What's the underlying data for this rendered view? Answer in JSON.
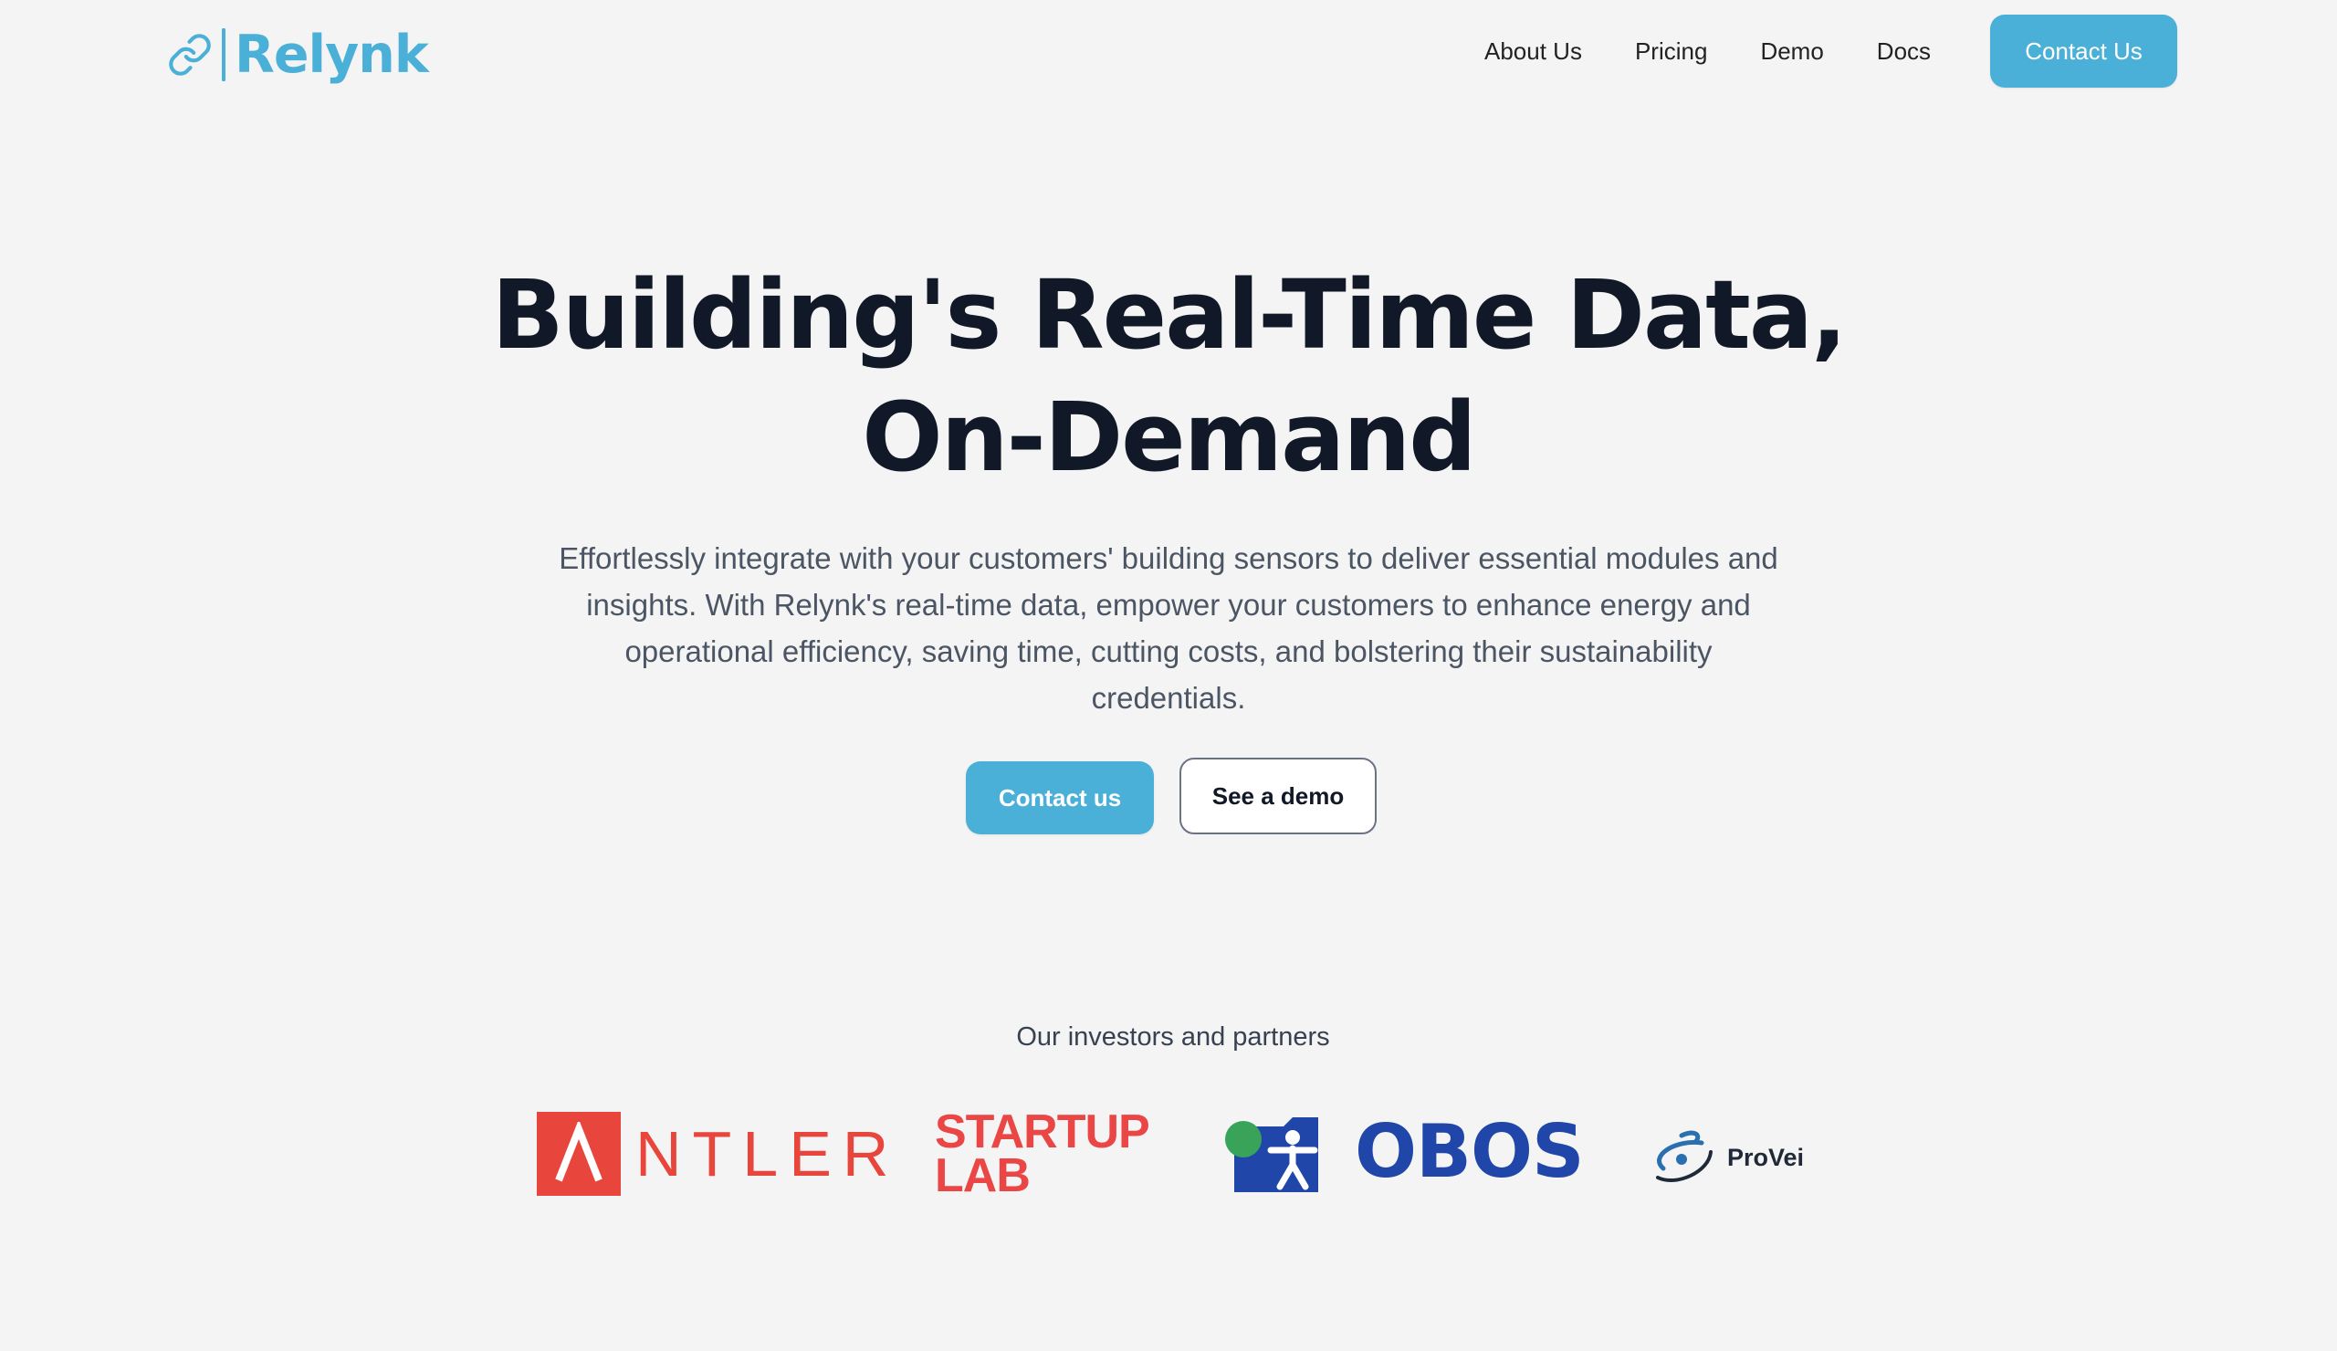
{
  "header": {
    "logo_text": "Relynk",
    "nav": [
      {
        "label": "About Us"
      },
      {
        "label": "Pricing"
      },
      {
        "label": "Demo"
      },
      {
        "label": "Docs"
      }
    ],
    "cta_label": "Contact Us"
  },
  "hero": {
    "title_line1": "Building's Real-Time Data,",
    "title_line2": "On-Demand",
    "subtitle": "Effortlessly integrate with your customers' building sensors to deliver essential modules and insights. With Relynk's real-time data, empower your customers to enhance energy and operational efficiency, saving time, cutting costs, and bolstering their sustainability credentials.",
    "primary_button": "Contact us",
    "secondary_button": "See a demo"
  },
  "partners": {
    "heading": "Our investors and partners",
    "logos": [
      {
        "name": "antler",
        "text": "NTLER"
      },
      {
        "name": "startup-lab",
        "line1": "STARTUP",
        "line2": "LAB"
      },
      {
        "name": "obos",
        "text": "OBOS"
      },
      {
        "name": "provei",
        "text": "ProVei"
      }
    ]
  },
  "colors": {
    "accent": "#4bb0d8",
    "background": "#f4f4f4",
    "heading": "#111827",
    "body_text": "#4b5563",
    "antler_red": "#e8453c",
    "startup_red": "#ea4646",
    "obos_blue": "#1f46a8",
    "obos_green": "#3aa35a"
  },
  "icons": {
    "logo": "chain-link-icon"
  }
}
